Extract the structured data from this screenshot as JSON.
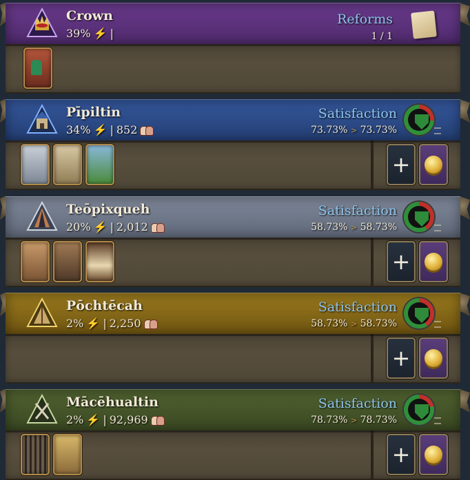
{
  "estates": [
    {
      "id": "crown",
      "name": "Crown",
      "stats": "39%",
      "sep": "|",
      "population": "",
      "right_label": "Reforms",
      "right_value": "1 / 1",
      "header_color": "#5a2f7a",
      "icon": "crown-icon"
    },
    {
      "id": "pipiltin",
      "name": "Pīpiltin",
      "stats": "34%",
      "sep": "|",
      "population": "852",
      "right_label": "Satisfaction",
      "sat_current": "73.73%",
      "sat_target": "73.73%",
      "header_color": "#2d4a86",
      "icon": "castle-icon",
      "satisfaction_level": 0.7373
    },
    {
      "id": "teopixqueh",
      "name": "Teōpixqueh",
      "stats": "20%",
      "sep": "|",
      "population": "2,012",
      "right_label": "Satisfaction",
      "sat_current": "58.73%",
      "sat_target": "58.73%",
      "header_color": "#6f7889",
      "icon": "temple-icon",
      "satisfaction_level": 0.5873
    },
    {
      "id": "pochtecah",
      "name": "Pōchtēcah",
      "stats": "2%",
      "sep": "|",
      "population": "2,250",
      "right_label": "Satisfaction",
      "sat_current": "58.73%",
      "sat_target": "58.73%",
      "header_color": "#8a6a16",
      "icon": "tent-icon",
      "satisfaction_level": 0.5873
    },
    {
      "id": "macehualtin",
      "name": "Mācēhualtin",
      "stats": "2%",
      "sep": "|",
      "population": "92,969",
      "right_label": "Satisfaction",
      "sat_current": "78.73%",
      "sat_target": "78.73%",
      "header_color": "#46552a",
      "icon": "tools-icon",
      "satisfaction_level": 0.7873
    }
  ],
  "buttons": {
    "add_label": "+"
  },
  "accent": {
    "satisfaction_blue": "#8fc5ec",
    "bolt": "#f5c518"
  }
}
